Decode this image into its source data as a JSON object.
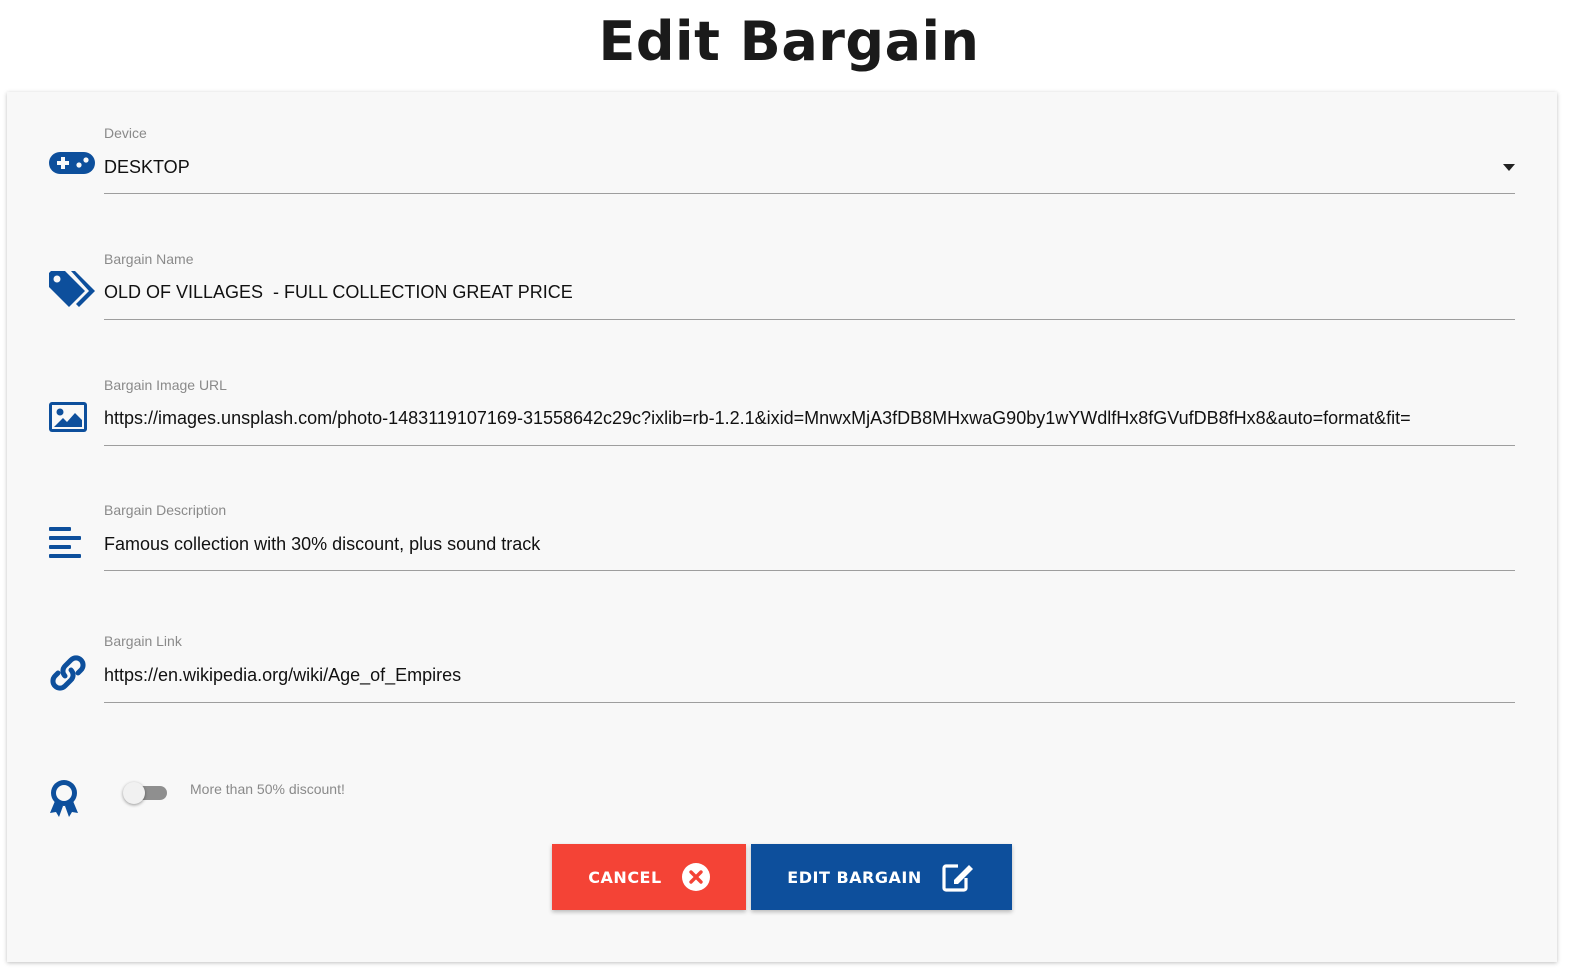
{
  "page": {
    "title": "Edit Bargain"
  },
  "form": {
    "device": {
      "label": "Device",
      "value": "DESKTOP",
      "icon": "gamepad-icon"
    },
    "name": {
      "label": "Bargain Name",
      "value": "OLD OF VILLAGES  - FULL COLLECTION GREAT PRICE",
      "icon": "tags-icon"
    },
    "image_url": {
      "label": "Bargain Image URL",
      "value": "https://images.unsplash.com/photo-1483119107169-31558642c29c?ixlib=rb-1.2.1&ixid=MnwxMjA3fDB8MHxwaG90by1wYWdlfHx8fGVufDB8fHx8&auto=format&fit=",
      "icon": "image-icon"
    },
    "description": {
      "label": "Bargain Description",
      "value": "Famous collection with 30% discount, plus sound track",
      "icon": "align-left-icon"
    },
    "link": {
      "label": "Bargain Link",
      "value": "https://en.wikipedia.org/wiki/Age_of_Empires",
      "icon": "link-icon"
    },
    "discount_toggle": {
      "label": "More than 50% discount!",
      "checked": false,
      "icon": "award-icon"
    }
  },
  "actions": {
    "cancel_label": "CANCEL",
    "submit_label": "EDIT BARGAIN"
  },
  "colors": {
    "accent": "#0d4f9c",
    "danger": "#f44336",
    "card_bg": "#f8f8f8"
  }
}
